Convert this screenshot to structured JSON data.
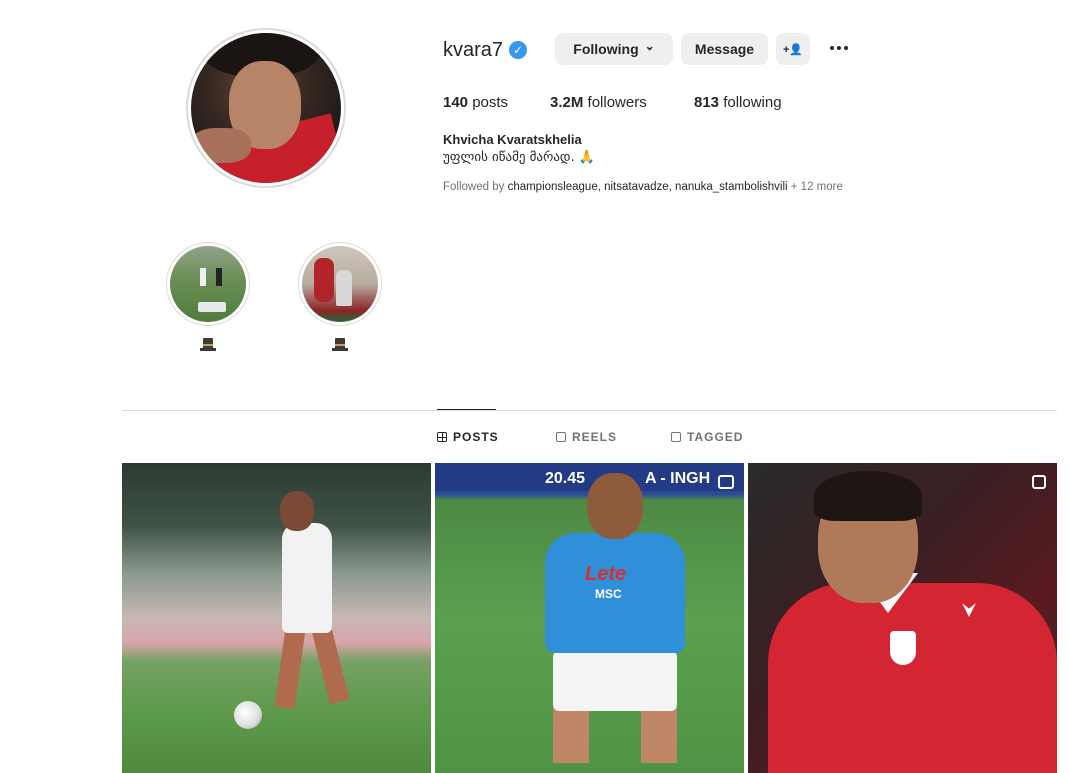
{
  "profile": {
    "username": "kvara7",
    "verified_mark": "✓",
    "full_name": "Khvicha Kvaratskhelia",
    "bio": "უფლის იწამე მარად. 🙏",
    "stats": {
      "posts_count": "140",
      "posts_label": "posts",
      "followers_count": "3.2M",
      "followers_label": "followers",
      "following_count": "813",
      "following_label": "following"
    },
    "followed_by": {
      "prefix": "Followed by ",
      "names": "championsleague, nitsatavadze, nanuka_stambolishvili",
      "suffix": " + 12 more"
    }
  },
  "actions": {
    "following_label": "Following",
    "following_chevron": "⌄",
    "message_label": "Message",
    "add_user_icon": "+👤"
  },
  "highlights": [
    {
      "label": "🎩"
    },
    {
      "label": "🎩"
    }
  ],
  "tabs": [
    {
      "label": "POSTS",
      "active": true
    },
    {
      "label": "REELS",
      "active": false
    },
    {
      "label": "TAGGED",
      "active": false
    }
  ],
  "posts": {
    "post2_score_left": "20.45",
    "post2_score_right": "A - INGH",
    "post2_sponsor": "Lete",
    "post2_sponsor2": "MSC"
  },
  "colors": {
    "verified": "#3797f0",
    "button_bg": "#efefef",
    "text_primary": "#262626",
    "text_secondary": "#737373"
  }
}
